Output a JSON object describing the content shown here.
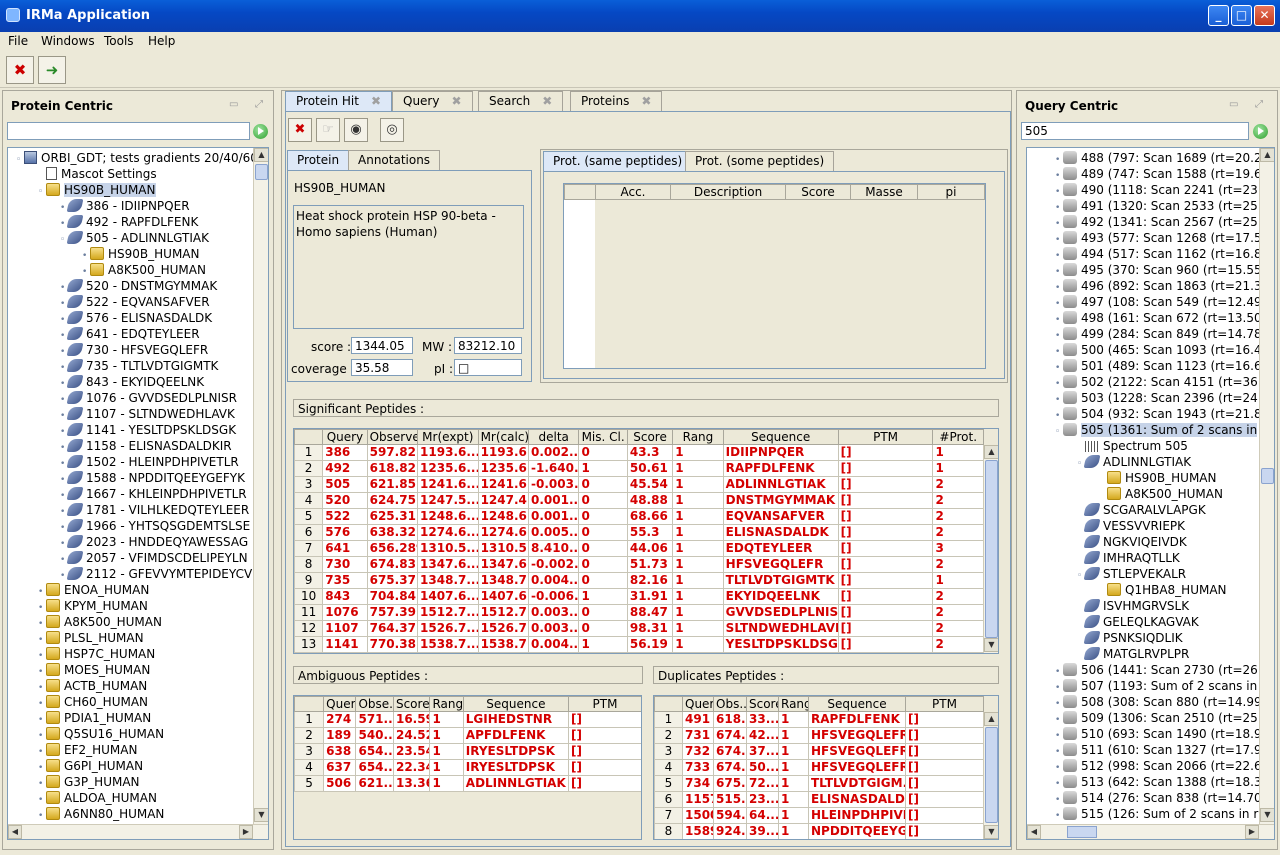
{
  "window": {
    "title": "IRMa Application",
    "minimize": "_",
    "maximize": "□",
    "close": "✕"
  },
  "menu": [
    "File",
    "Windows",
    "Tools",
    "Help"
  ],
  "toolbar": {
    "icons": [
      "close-red-icon",
      "export-icon"
    ],
    "close_glyph": "✖",
    "export_glyph": "➜"
  },
  "left": {
    "title": "Protein Centric",
    "search_value": "",
    "tree": [
      {
        "t": "ORBI_GDT; tests gradients 20/40/60",
        "i": "db",
        "lvl": 0,
        "ex": "-"
      },
      {
        "t": "Mascot Settings",
        "i": "doc",
        "lvl": 1,
        "ex": ""
      },
      {
        "t": "HS90B_HUMAN",
        "i": "prot",
        "lvl": 1,
        "ex": "-",
        "sel": true
      },
      {
        "t": "386 - IDIIPNPQER",
        "i": "pep",
        "lvl": 2,
        "ex": "+"
      },
      {
        "t": "492 - RAPFDLFENK",
        "i": "pep",
        "lvl": 2,
        "ex": "+"
      },
      {
        "t": "505 - ADLINNLGTIAK",
        "i": "pep",
        "lvl": 2,
        "ex": "-"
      },
      {
        "t": "HS90B_HUMAN",
        "i": "prot",
        "lvl": 3,
        "ex": "+"
      },
      {
        "t": "A8K500_HUMAN",
        "i": "prot",
        "lvl": 3,
        "ex": "+"
      },
      {
        "t": "520 - DNSTMGYMMAK",
        "i": "pep",
        "lvl": 2,
        "ex": "+"
      },
      {
        "t": "522 - EQVANSAFVER",
        "i": "pep",
        "lvl": 2,
        "ex": "+"
      },
      {
        "t": "576 - ELISNASDALDK",
        "i": "pep",
        "lvl": 2,
        "ex": "+"
      },
      {
        "t": "641 - EDQTEYLEER",
        "i": "pep",
        "lvl": 2,
        "ex": "+"
      },
      {
        "t": "730 - HFSVEGQLEFR",
        "i": "pep",
        "lvl": 2,
        "ex": "+"
      },
      {
        "t": "735 - TLTLVDTGIGMTK",
        "i": "pep",
        "lvl": 2,
        "ex": "+"
      },
      {
        "t": "843 - EKYIDQEELNK",
        "i": "pep",
        "lvl": 2,
        "ex": "+"
      },
      {
        "t": "1076 - GVVDSEDLPLNISR",
        "i": "pep",
        "lvl": 2,
        "ex": "+"
      },
      {
        "t": "1107 - SLTNDWEDHLAVK",
        "i": "pep",
        "lvl": 2,
        "ex": "+"
      },
      {
        "t": "1141 - YESLTDPSKLDSGK",
        "i": "pep",
        "lvl": 2,
        "ex": "+"
      },
      {
        "t": "1158 - ELISNASDALDKIR",
        "i": "pep",
        "lvl": 2,
        "ex": "+"
      },
      {
        "t": "1502 - HLEINPDHPIVETLR",
        "i": "pep",
        "lvl": 2,
        "ex": "+"
      },
      {
        "t": "1588 - NPDDITQEEYGEFYK",
        "i": "pep",
        "lvl": 2,
        "ex": "+"
      },
      {
        "t": "1667 - KHLEINPDHPIVETLR",
        "i": "pep",
        "lvl": 2,
        "ex": "+"
      },
      {
        "t": "1781 - VILHLKEDQTEYLEER",
        "i": "pep",
        "lvl": 2,
        "ex": "+"
      },
      {
        "t": "1966 - YHTSQSGDEMTSLSE",
        "i": "pep",
        "lvl": 2,
        "ex": "+"
      },
      {
        "t": "2023 - HNDDEQYAWESSAG",
        "i": "pep",
        "lvl": 2,
        "ex": "+"
      },
      {
        "t": "2057 - VFIMDSCDELIPEYLN",
        "i": "pep",
        "lvl": 2,
        "ex": "+"
      },
      {
        "t": "2112 - GFEVVYMTEPIDEYCV",
        "i": "pep",
        "lvl": 2,
        "ex": "+"
      },
      {
        "t": "ENOA_HUMAN",
        "i": "prot",
        "lvl": 1,
        "ex": "+"
      },
      {
        "t": "KPYM_HUMAN",
        "i": "prot",
        "lvl": 1,
        "ex": "+"
      },
      {
        "t": "A8K500_HUMAN",
        "i": "prot",
        "lvl": 1,
        "ex": "+"
      },
      {
        "t": "PLSL_HUMAN",
        "i": "prot",
        "lvl": 1,
        "ex": "+"
      },
      {
        "t": "HSP7C_HUMAN",
        "i": "prot",
        "lvl": 1,
        "ex": "+"
      },
      {
        "t": "MOES_HUMAN",
        "i": "prot",
        "lvl": 1,
        "ex": "+"
      },
      {
        "t": "ACTB_HUMAN",
        "i": "prot",
        "lvl": 1,
        "ex": "+"
      },
      {
        "t": "CH60_HUMAN",
        "i": "prot",
        "lvl": 1,
        "ex": "+"
      },
      {
        "t": "PDIA1_HUMAN",
        "i": "prot",
        "lvl": 1,
        "ex": "+"
      },
      {
        "t": "Q5SU16_HUMAN",
        "i": "prot",
        "lvl": 1,
        "ex": "+"
      },
      {
        "t": "EF2_HUMAN",
        "i": "prot",
        "lvl": 1,
        "ex": "+"
      },
      {
        "t": "G6PI_HUMAN",
        "i": "prot",
        "lvl": 1,
        "ex": "+"
      },
      {
        "t": "G3P_HUMAN",
        "i": "prot",
        "lvl": 1,
        "ex": "+"
      },
      {
        "t": "ALDOA_HUMAN",
        "i": "prot",
        "lvl": 1,
        "ex": "+"
      },
      {
        "t": "A6NN80_HUMAN",
        "i": "prot",
        "lvl": 1,
        "ex": "+"
      }
    ]
  },
  "center": {
    "tabs": [
      "Protein Hit",
      "Query",
      "Search",
      "Proteins"
    ],
    "subtabs_left": [
      "Protein",
      "Annotations"
    ],
    "subtabs_right": [
      "Prot. (same peptides)",
      "Prot. (some peptides)"
    ],
    "protein": {
      "name": "HS90B_HUMAN",
      "description": "Heat shock protein HSP 90-beta - Homo sapiens (Human)",
      "score_label": "score :",
      "score": "1344.05",
      "mw_label": "MW :",
      "mw": "83212.10",
      "coverage_label": "coverage :",
      "coverage": "35.58",
      "pi_label": "pI :",
      "pi": "□"
    },
    "same_peptides_headers": [
      "Acc.",
      "Description",
      "Score",
      "Masse",
      "pi"
    ],
    "significant": {
      "title": "Significant Peptides :",
      "headers": [
        "Query",
        "Observed",
        "Mr(expt)",
        "Mr(calc)",
        "delta",
        "Mis. Cl.",
        "Score",
        "Rang",
        "Sequence",
        "PTM",
        "#Prot."
      ],
      "rows": [
        [
          "1",
          "386",
          "597.82...",
          "1193.6...",
          "1193.6...",
          "0.002...",
          "0",
          "43.3",
          "1",
          "IDIIPNPQER",
          "[]",
          "1"
        ],
        [
          "2",
          "492",
          "618.82...",
          "1235.6...",
          "1235.6...",
          "-1.640...",
          "1",
          "50.61",
          "1",
          "RAPFDLFENK",
          "[]",
          "1"
        ],
        [
          "3",
          "505",
          "621.85...",
          "1241.6...",
          "1241.6...",
          "-0.003...",
          "0",
          "45.54",
          "1",
          "ADLINNLGTIAK",
          "[]",
          "2"
        ],
        [
          "4",
          "520",
          "624.75...",
          "1247.5...",
          "1247.4...",
          "0.001...",
          "0",
          "48.88",
          "1",
          "DNSTMGYMMAK",
          "[]",
          "2"
        ],
        [
          "5",
          "522",
          "625.31...",
          "1248.6...",
          "1248.6...",
          "0.001...",
          "0",
          "68.66",
          "1",
          "EQVANSAFVER",
          "[]",
          "2"
        ],
        [
          "6",
          "576",
          "638.32...",
          "1274.6...",
          "1274.6...",
          "0.005...",
          "0",
          "55.3",
          "1",
          "ELISNASDALDK",
          "[]",
          "2"
        ],
        [
          "7",
          "641",
          "656.289",
          "1310.5...",
          "1310.5...",
          "8.410...",
          "0",
          "44.06",
          "1",
          "EDQTEYLEER",
          "[]",
          "3"
        ],
        [
          "8",
          "730",
          "674.83...",
          "1347.6...",
          "1347.6...",
          "-0.002...",
          "0",
          "51.73",
          "1",
          "HFSVEGQLEFR",
          "[]",
          "2"
        ],
        [
          "9",
          "735",
          "675.37...",
          "1348.7...",
          "1348.7...",
          "0.004...",
          "0",
          "82.16",
          "1",
          "TLTLVDTGIGMTK",
          "[]",
          "1"
        ],
        [
          "10",
          "843",
          "704.84...",
          "1407.6...",
          "1407.6...",
          "-0.006...",
          "1",
          "31.91",
          "1",
          "EKYIDQEELNK",
          "[]",
          "2"
        ],
        [
          "11",
          "1076",
          "757.39...",
          "1512.7...",
          "1512.7...",
          "0.003...",
          "0",
          "88.47",
          "1",
          "GVVDSEDLPLNISR",
          "[]",
          "2"
        ],
        [
          "12",
          "1107",
          "764.37...",
          "1526.7...",
          "1526.7...",
          "0.003...",
          "0",
          "98.31",
          "1",
          "SLTNDWEDHLAVK",
          "[]",
          "2"
        ],
        [
          "13",
          "1141",
          "770.38...",
          "1538.7...",
          "1538.7...",
          "0.004...",
          "1",
          "56.19",
          "1",
          "YESLTDPSKLDSGK",
          "[]",
          "2"
        ]
      ]
    },
    "ambiguous": {
      "title": "Ambiguous Peptides :",
      "headers": [
        "Query",
        "Obse...",
        "Score",
        "Rang",
        "Sequence",
        "PTM"
      ],
      "rows": [
        [
          "1",
          "274",
          "571....",
          "16.59",
          "1",
          "LGIHEDSTNR",
          "[]"
        ],
        [
          "2",
          "189",
          "540....",
          "24.52",
          "1",
          "APFDLFENK",
          "[]"
        ],
        [
          "3",
          "638",
          "654....",
          "23.54",
          "1",
          "IRYESLTDPSK",
          "[]"
        ],
        [
          "4",
          "637",
          "654....",
          "22.34",
          "1",
          "IRYESLTDPSK",
          "[]"
        ],
        [
          "5",
          "506",
          "621....",
          "13.36",
          "1",
          "ADLINNLGTIAK",
          "[]"
        ]
      ]
    },
    "duplicates": {
      "title": "Duplicates Peptides :",
      "headers": [
        "Query",
        "Obs...",
        "Score",
        "Rang",
        "Sequence",
        "PTM"
      ],
      "rows": [
        [
          "1",
          "491",
          "618....",
          "33....",
          "1",
          "RAPFDLFENK",
          "[]"
        ],
        [
          "2",
          "731",
          "674....",
          "42....",
          "1",
          "HFSVEGQLEFR",
          "[]"
        ],
        [
          "3",
          "732",
          "674....",
          "37....",
          "1",
          "HFSVEGQLEFR",
          "[]"
        ],
        [
          "4",
          "733",
          "674....",
          "50....",
          "1",
          "HFSVEGQLEFR",
          "[]"
        ],
        [
          "5",
          "734",
          "675....",
          "72....",
          "1",
          "TLTLVDTGIGM...",
          "[]"
        ],
        [
          "6",
          "1157",
          "515....",
          "23....",
          "1",
          "ELISNASDALD...",
          "[]"
        ],
        [
          "7",
          "1500",
          "594....",
          "64....",
          "1",
          "HLEINPDHPIVE...",
          "[]"
        ],
        [
          "8",
          "1589",
          "924....",
          "39....",
          "1",
          "NPDDITQEEYG...",
          "[]"
        ]
      ]
    }
  },
  "right": {
    "title": "Query Centric",
    "search_value": "505",
    "tree": [
      {
        "t": "488 (797: Scan 1689 (rt=20.25",
        "i": "q",
        "lvl": 1,
        "ex": "+"
      },
      {
        "t": "489 (747: Scan 1588 (rt=19.62",
        "i": "q",
        "lvl": 1,
        "ex": "+"
      },
      {
        "t": "490 (1118: Scan 2241 (rt=23.7",
        "i": "q",
        "lvl": 1,
        "ex": "+"
      },
      {
        "t": "491 (1320: Scan 2533 (rt=25.5",
        "i": "q",
        "lvl": 1,
        "ex": "+"
      },
      {
        "t": "492 (1341: Scan 2567 (rt=25.8",
        "i": "q",
        "lvl": 1,
        "ex": "+"
      },
      {
        "t": "493 (577: Scan 1268 (rt=17.56",
        "i": "q",
        "lvl": 1,
        "ex": "+"
      },
      {
        "t": "494 (517: Scan 1162 (rt=16.88",
        "i": "q",
        "lvl": 1,
        "ex": "+"
      },
      {
        "t": "495 (370: Scan 960 (rt=15.553",
        "i": "q",
        "lvl": 1,
        "ex": "+"
      },
      {
        "t": "496 (892: Scan 1863 (rt=21.36",
        "i": "q",
        "lvl": 1,
        "ex": "+"
      },
      {
        "t": "497 (108: Scan 549 (rt=12.498",
        "i": "q",
        "lvl": 1,
        "ex": "+"
      },
      {
        "t": "498 (161: Scan 672 (rt=13.509",
        "i": "q",
        "lvl": 1,
        "ex": "+"
      },
      {
        "t": "499 (284: Scan 849 (rt=14.782",
        "i": "q",
        "lvl": 1,
        "ex": "+"
      },
      {
        "t": "500 (465: Scan 1093 (rt=16.43",
        "i": "q",
        "lvl": 1,
        "ex": "+"
      },
      {
        "t": "501 (489: Scan 1123 (rt=16.63",
        "i": "q",
        "lvl": 1,
        "ex": "+"
      },
      {
        "t": "502 (2122: Scan 4151 (rt=36.0",
        "i": "q",
        "lvl": 1,
        "ex": "+"
      },
      {
        "t": "503 (1228: Scan 2396 (rt=24.7",
        "i": "q",
        "lvl": 1,
        "ex": "+"
      },
      {
        "t": "504 (932: Scan 1943 (rt=21.86",
        "i": "q",
        "lvl": 1,
        "ex": "+"
      },
      {
        "t": "505 (1361: Sum of 2 scans in",
        "i": "q",
        "lvl": 1,
        "ex": "-",
        "sel": true
      },
      {
        "t": "Spectrum 505",
        "i": "spec",
        "lvl": 2,
        "ex": ""
      },
      {
        "t": "ADLINNLGTIAK",
        "i": "pep",
        "lvl": 2,
        "ex": "-"
      },
      {
        "t": "HS90B_HUMAN",
        "i": "prot",
        "lvl": 3,
        "ex": ""
      },
      {
        "t": "A8K500_HUMAN",
        "i": "prot",
        "lvl": 3,
        "ex": ""
      },
      {
        "t": "SCGARALVLAPGK",
        "i": "pep",
        "lvl": 2,
        "ex": ""
      },
      {
        "t": "VESSVVRIEPK",
        "i": "pep",
        "lvl": 2,
        "ex": ""
      },
      {
        "t": "NGKVIQEIVDK",
        "i": "pep",
        "lvl": 2,
        "ex": ""
      },
      {
        "t": "IMHRAQTLLK",
        "i": "pep",
        "lvl": 2,
        "ex": ""
      },
      {
        "t": "STLEPVEKALR",
        "i": "pep",
        "lvl": 2,
        "ex": "-"
      },
      {
        "t": "Q1HBA8_HUMAN",
        "i": "prot",
        "lvl": 3,
        "ex": ""
      },
      {
        "t": "ISVHMGRVSLK",
        "i": "pep",
        "lvl": 2,
        "ex": ""
      },
      {
        "t": "GELEQLKAGVAK",
        "i": "pep",
        "lvl": 2,
        "ex": ""
      },
      {
        "t": "PSNKSIQDLIK",
        "i": "pep",
        "lvl": 2,
        "ex": ""
      },
      {
        "t": "MATGLRVPLPR",
        "i": "pep",
        "lvl": 2,
        "ex": ""
      },
      {
        "t": "506 (1441: Scan 2730 (rt=26.8",
        "i": "q",
        "lvl": 1,
        "ex": "+"
      },
      {
        "t": "507 (1193: Sum of 2 scans in r",
        "i": "q",
        "lvl": 1,
        "ex": "+"
      },
      {
        "t": "508 (308: Scan 880 (rt=14.997",
        "i": "q",
        "lvl": 1,
        "ex": "+"
      },
      {
        "t": "509 (1306: Scan 2510 (rt=25.4",
        "i": "q",
        "lvl": 1,
        "ex": "+"
      },
      {
        "t": "510 (693: Scan 1490 (rt=18.99",
        "i": "q",
        "lvl": 1,
        "ex": "+"
      },
      {
        "t": "511 (610: Scan 1327 (rt=17.95",
        "i": "q",
        "lvl": 1,
        "ex": "+"
      },
      {
        "t": "512 (998: Scan 2066 (rt=22.63",
        "i": "q",
        "lvl": 1,
        "ex": "+"
      },
      {
        "t": "513 (642: Scan 1388 (rt=18.34",
        "i": "q",
        "lvl": 1,
        "ex": "+"
      },
      {
        "t": "514 (276: Scan 838 (rt=14.703",
        "i": "q",
        "lvl": 1,
        "ex": "+"
      },
      {
        "t": "515 (126: Sum of 2 scans in r",
        "i": "q",
        "lvl": 1,
        "ex": "+"
      }
    ]
  }
}
